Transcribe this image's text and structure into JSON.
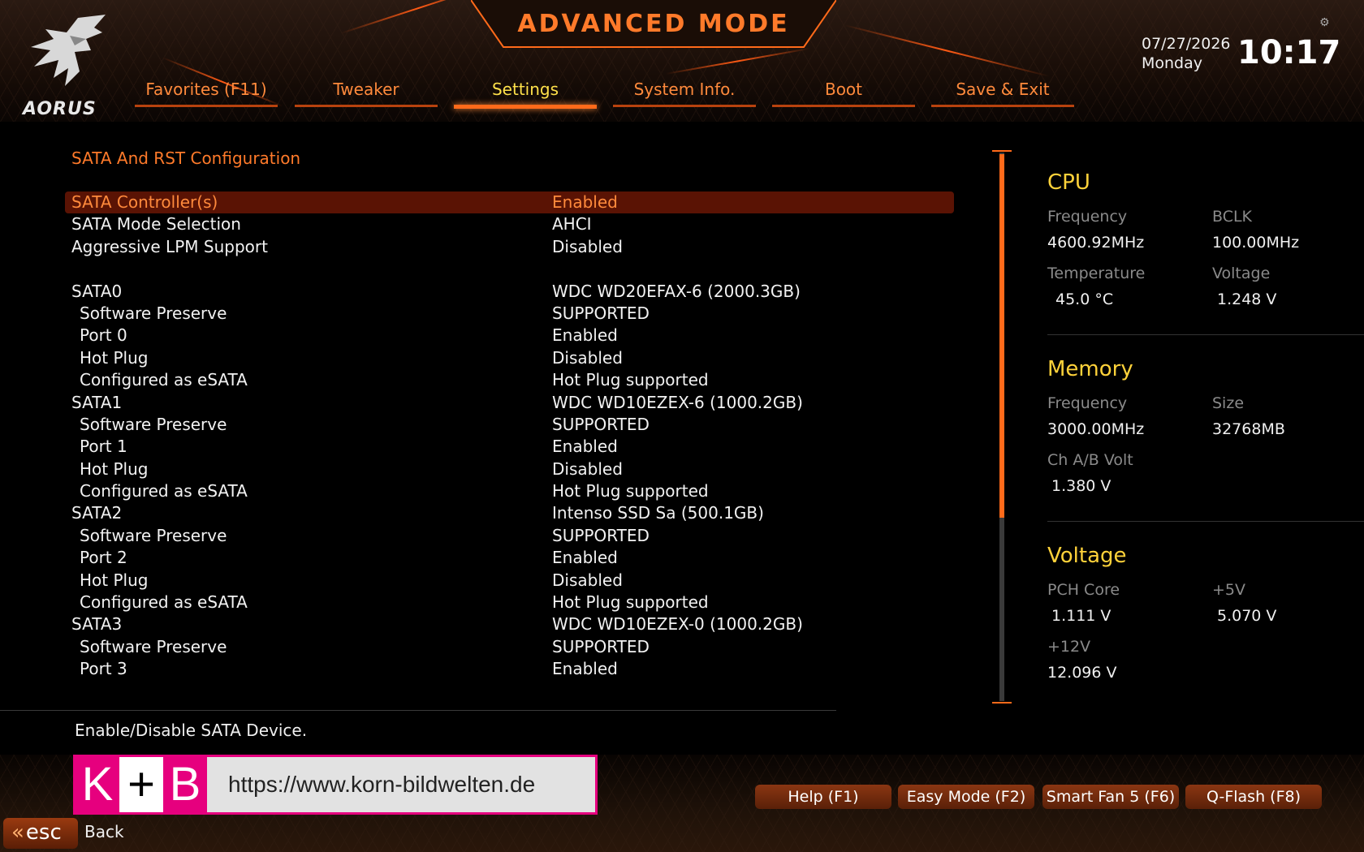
{
  "header": {
    "title": "ADVANCED MODE",
    "brand": "AORUS",
    "date": "07/27/2026",
    "weekday": "Monday",
    "time": "10:17",
    "accent": "#ff6a1a"
  },
  "tabs": [
    {
      "label": "Favorites (F11)",
      "active": false
    },
    {
      "label": "Tweaker",
      "active": false
    },
    {
      "label": "Settings",
      "active": true
    },
    {
      "label": "System Info.",
      "active": false
    },
    {
      "label": "Boot",
      "active": false
    },
    {
      "label": "Save & Exit",
      "active": false
    }
  ],
  "main": {
    "section_title": "SATA And RST Configuration",
    "rows": [
      {
        "label": "SATA Controller(s)",
        "value": "Enabled",
        "indent": false,
        "selected": true
      },
      {
        "label": "SATA Mode Selection",
        "value": "AHCI",
        "indent": false
      },
      {
        "label": "Aggressive LPM Support",
        "value": "Disabled",
        "indent": false
      },
      {
        "label": "",
        "value": "",
        "indent": false,
        "gap": true
      },
      {
        "label": "SATA0",
        "value": "WDC WD20EFAX-6 (2000.3GB)",
        "indent": false
      },
      {
        "label": "Software Preserve",
        "value": "SUPPORTED",
        "indent": true
      },
      {
        "label": "Port 0",
        "value": "Enabled",
        "indent": true
      },
      {
        "label": "Hot Plug",
        "value": "Disabled",
        "indent": true
      },
      {
        "label": "Configured as eSATA",
        "value": "Hot Plug supported",
        "indent": true
      },
      {
        "label": "SATA1",
        "value": "WDC WD10EZEX-6 (1000.2GB)",
        "indent": false
      },
      {
        "label": "Software Preserve",
        "value": "SUPPORTED",
        "indent": true
      },
      {
        "label": "Port 1",
        "value": "Enabled",
        "indent": true
      },
      {
        "label": "Hot Plug",
        "value": "Disabled",
        "indent": true
      },
      {
        "label": "Configured as eSATA",
        "value": "Hot Plug supported",
        "indent": true
      },
      {
        "label": "SATA2",
        "value": "Intenso SSD Sa (500.1GB)",
        "indent": false
      },
      {
        "label": "Software Preserve",
        "value": "SUPPORTED",
        "indent": true
      },
      {
        "label": "Port 2",
        "value": "Enabled",
        "indent": true
      },
      {
        "label": "Hot Plug",
        "value": "Disabled",
        "indent": true
      },
      {
        "label": "Configured as eSATA",
        "value": "Hot Plug supported",
        "indent": true
      },
      {
        "label": "SATA3",
        "value": "WDC WD10EZEX-0 (1000.2GB)",
        "indent": false
      },
      {
        "label": "Software Preserve",
        "value": "SUPPORTED",
        "indent": true
      },
      {
        "label": "Port 3",
        "value": "Enabled",
        "indent": true
      }
    ],
    "help_text": "Enable/Disable SATA Device.",
    "scroll_fraction_visible": 0.66
  },
  "panel": {
    "cpu": {
      "title": "CPU",
      "frequency_label": "Frequency",
      "frequency": "4600.92MHz",
      "bclk_label": "BCLK",
      "bclk": "100.00MHz",
      "temperature_label": "Temperature",
      "temperature": "45.0 °C",
      "voltage_label": "Voltage",
      "voltage": "1.248 V"
    },
    "memory": {
      "title": "Memory",
      "frequency_label": "Frequency",
      "frequency": "3000.00MHz",
      "size_label": "Size",
      "size": "32768MB",
      "chvolt_label": "Ch A/B Volt",
      "chvolt": "1.380 V"
    },
    "voltage": {
      "title": "Voltage",
      "pch_label": "PCH Core",
      "pch": "1.111 V",
      "p5v_label": "+5V",
      "p5v": "5.070 V",
      "p12v_label": "+12V",
      "p12v": "12.096 V"
    }
  },
  "footer": {
    "buttons": [
      "Help (F1)",
      "Easy Mode (F2)",
      "Smart Fan 5 (F6)",
      "Q-Flash (F8)"
    ],
    "esc_label": "esc",
    "back_label": "Back"
  },
  "watermark": {
    "k": "K",
    "plus": "+",
    "b": "B",
    "url": "https://www.korn-bildwelten.de"
  }
}
